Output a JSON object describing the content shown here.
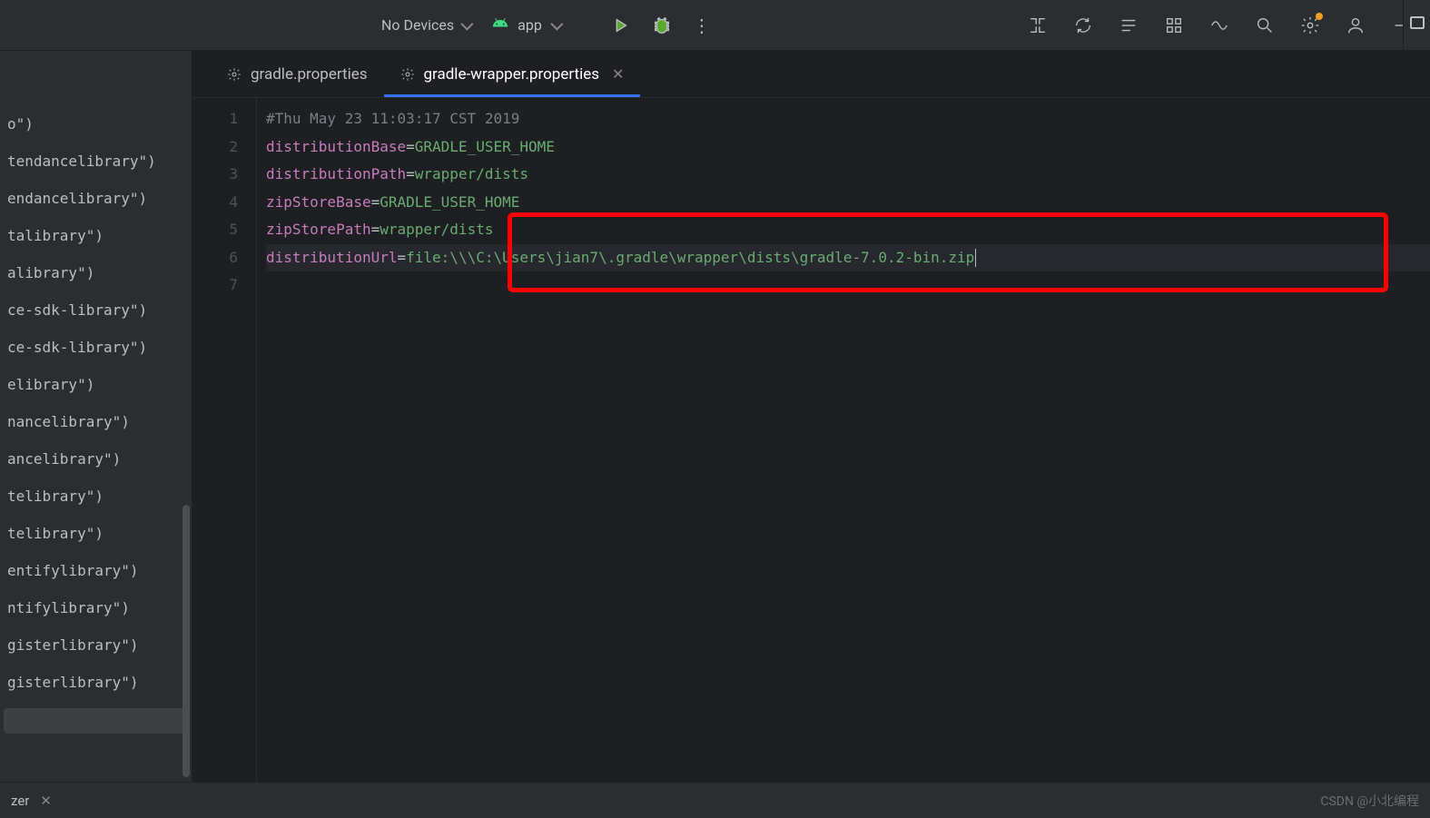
{
  "toolbar": {
    "device_label": "No Devices",
    "run_config": "app",
    "more": "⋮"
  },
  "sidebar": {
    "items": [
      "o\")",
      "tendancelibrary\")",
      "endancelibrary\")",
      "talibrary\")",
      "alibrary\")",
      "ce-sdk-library\")",
      "ce-sdk-library\")",
      "elibrary\")",
      "nancelibrary\")",
      "ancelibrary\")",
      "telibrary\")",
      "telibrary\")",
      "entifylibrary\")",
      "ntifylibrary\")",
      "gisterlibrary\")",
      "gisterlibrary\")"
    ]
  },
  "tabs": [
    {
      "label": "gradle.properties",
      "active": false,
      "closeable": false
    },
    {
      "label": "gradle-wrapper.properties",
      "active": true,
      "closeable": true
    }
  ],
  "editor": {
    "gutter": [
      "1",
      "2",
      "3",
      "4",
      "5",
      "6",
      "7"
    ],
    "lines": [
      {
        "type": "comment",
        "text": "#Thu May 23 11:03:17 CST 2019"
      },
      {
        "type": "prop",
        "key": "distributionBase",
        "val": "GRADLE_USER_HOME"
      },
      {
        "type": "prop",
        "key": "distributionPath",
        "val": "wrapper/dists"
      },
      {
        "type": "prop",
        "key": "zipStoreBase",
        "val": "GRADLE_USER_HOME"
      },
      {
        "type": "prop",
        "key": "zipStorePath",
        "val": "wrapper/dists"
      },
      {
        "type": "prop",
        "key": "distributionUrl",
        "val": "file:\\\\\\C:\\Users\\jian7\\.gradle\\wrapper\\dists\\gradle-7.0.2-bin.zip",
        "current": true
      },
      {
        "type": "blank",
        "text": ""
      }
    ]
  },
  "bottom": {
    "label": "zer",
    "watermark": "CSDN @小北编程"
  }
}
